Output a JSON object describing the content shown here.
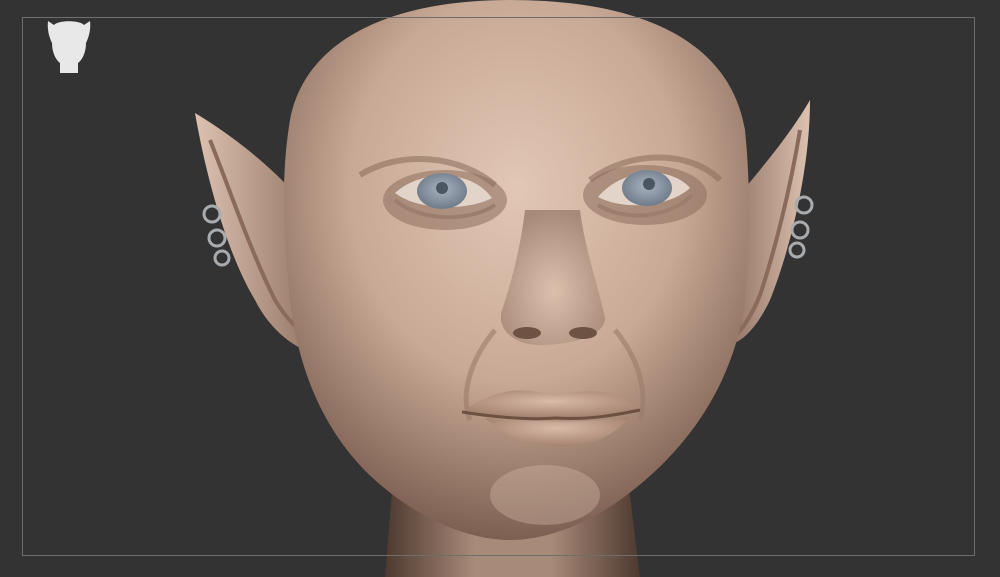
{
  "viewport": {
    "background_color": "#333333",
    "frame_color": "#6e6e6e"
  },
  "icons": {
    "camera_view_icon": "head-silhouette-icon",
    "camera_view_icon_color": "#e8e8e8"
  },
  "model": {
    "material_color": "#c8a995",
    "shadow_color": "#5e463b",
    "highlight_color": "#ecd6c6",
    "eye_color": "#8b98a6",
    "earring_color": "#a9acae"
  }
}
